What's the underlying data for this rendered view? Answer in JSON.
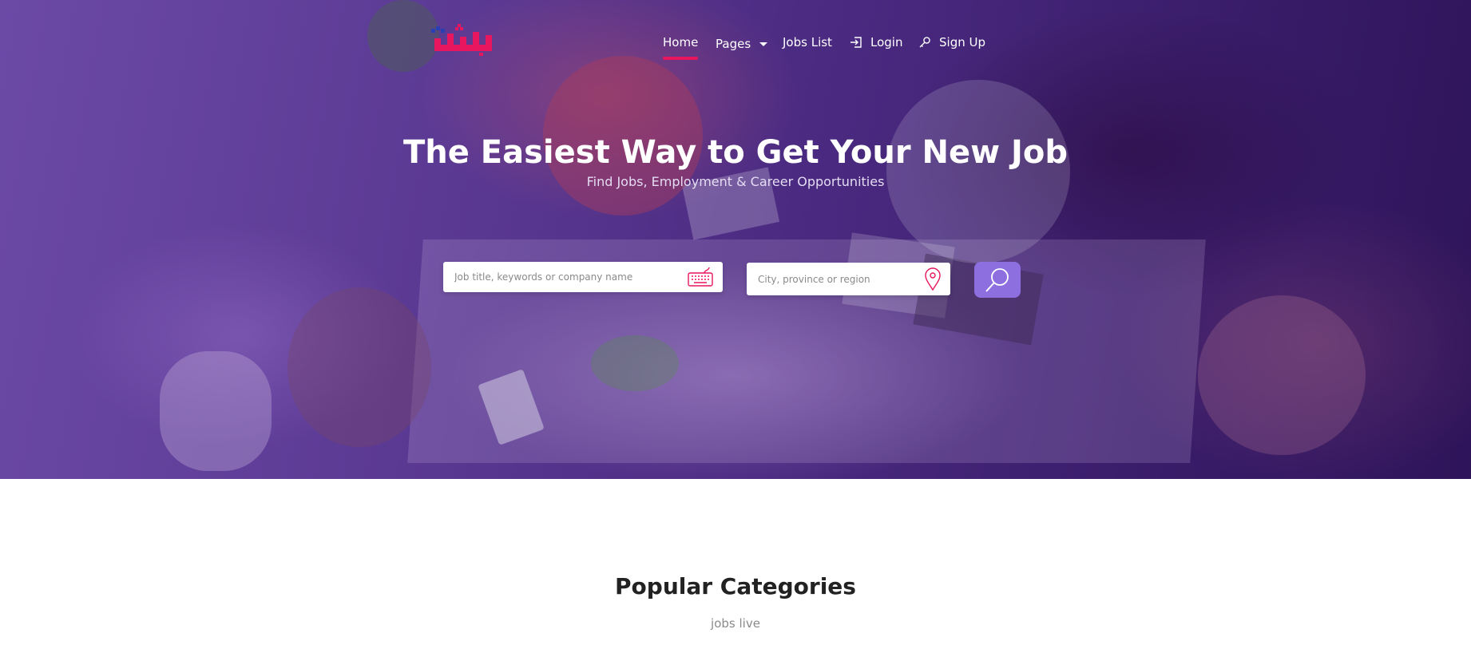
{
  "brand": {
    "logo_text": "وارسه",
    "accent_color": "#e8155f",
    "secondary_color": "#2b3fb5"
  },
  "nav": {
    "items": [
      {
        "label": "Home",
        "active": true
      },
      {
        "label": "Pages",
        "has_dropdown": true
      },
      {
        "label": "Jobs List"
      },
      {
        "label": "Login",
        "icon": "login-icon"
      },
      {
        "label": "Sign Up",
        "icon": "key-icon"
      }
    ]
  },
  "hero": {
    "title": "The Easiest Way to Get Your New Job",
    "subtitle": "Find Jobs, Employment & Career Opportunities"
  },
  "search": {
    "keyword_placeholder": "Job title, keywords or company name",
    "keyword_icon": "keyboard-icon",
    "location_placeholder": "City, province or region",
    "location_icon": "map-pin-icon",
    "button_icon": "search-icon",
    "button_color": "#8e6fe0"
  },
  "categories": {
    "title": "Popular Categories",
    "subtitle": "jobs live"
  }
}
